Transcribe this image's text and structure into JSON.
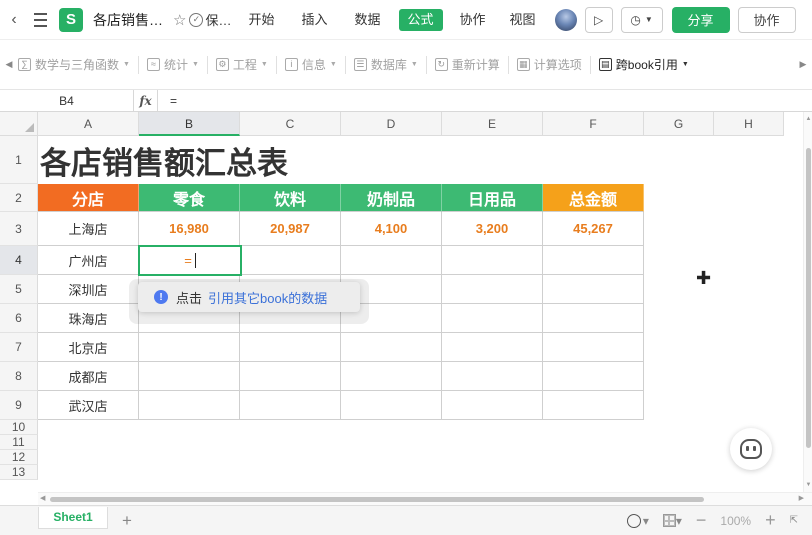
{
  "header": {
    "doc_title": "各店销售…",
    "save_label": "保…",
    "tabs": [
      {
        "label": "开始"
      },
      {
        "label": "插入"
      },
      {
        "label": "数据"
      },
      {
        "label": "公式"
      },
      {
        "label": "协作"
      },
      {
        "label": "视图"
      }
    ],
    "active_tab": "公式",
    "share_label": "分享",
    "collab_label": "协作"
  },
  "ribbon": {
    "items": [
      {
        "label": "数学与三角函数",
        "icon": "calc-icon",
        "dropdown": true
      },
      {
        "label": "统计",
        "icon": "stats-icon",
        "dropdown": true
      },
      {
        "label": "工程",
        "icon": "engineering-icon",
        "dropdown": true
      },
      {
        "label": "信息",
        "icon": "info-icon",
        "dropdown": true
      },
      {
        "label": "数据库",
        "icon": "database-icon",
        "dropdown": true
      },
      {
        "label": "重新计算",
        "icon": "recalc-icon",
        "dropdown": false
      },
      {
        "label": "计算选项",
        "icon": "calc-options-icon",
        "dropdown": false
      },
      {
        "label": "跨book引用",
        "icon": "cross-book-icon",
        "dropdown": true
      }
    ]
  },
  "formula_bar": {
    "cell_ref": "B4",
    "fx": "fx",
    "content": "="
  },
  "columns": [
    "A",
    "B",
    "C",
    "D",
    "E",
    "F",
    "G",
    "H"
  ],
  "rows": [
    "1",
    "2",
    "3",
    "4",
    "5",
    "6",
    "7",
    "8",
    "9",
    "10",
    "11",
    "12",
    "13"
  ],
  "sheet": {
    "title": "各店销售额汇总表",
    "headers": [
      "分店",
      "零食",
      "饮料",
      "奶制品",
      "日用品",
      "总金额"
    ],
    "header_colors": [
      "#f26c22",
      "#3dba73",
      "#3dba73",
      "#3dba73",
      "#3dba73",
      "#f5a11a"
    ],
    "stores": [
      "上海店",
      "广州店",
      "深圳店",
      "珠海店",
      "北京店",
      "成都店",
      "武汉店"
    ],
    "shanghai_values": [
      "16,980",
      "20,987",
      "4,100",
      "3,200",
      "45,267"
    ],
    "active_input": "="
  },
  "hint": {
    "text": "点击",
    "link": "引用其它book的数据"
  },
  "status": {
    "sheet_tab": "Sheet1",
    "zoom": "100%"
  },
  "colors": {
    "accent": "#27b065",
    "number": "#e87d1e",
    "link": "#3a70d8"
  }
}
